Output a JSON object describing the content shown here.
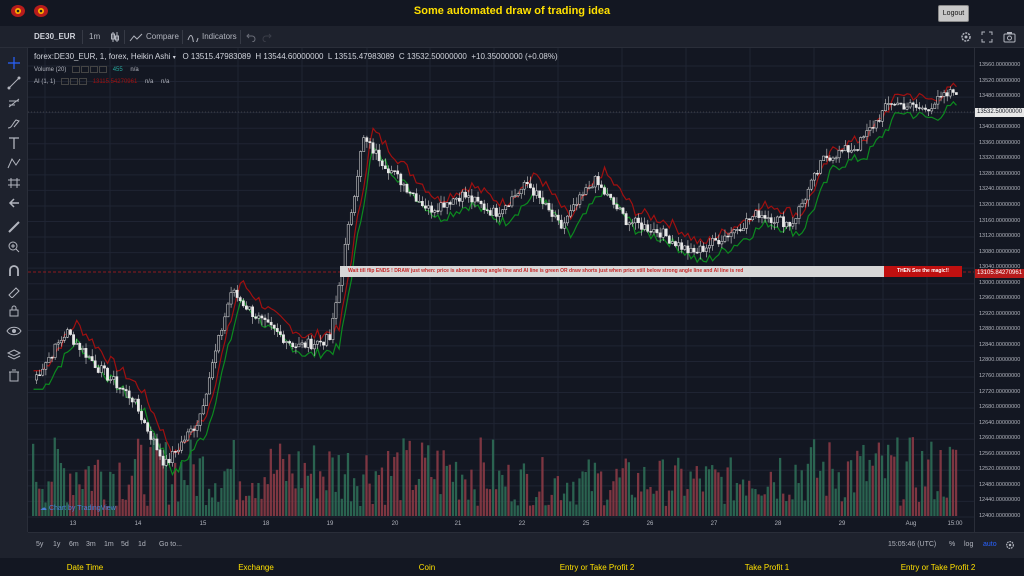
{
  "app": {
    "title": "Some automated draw of trading idea",
    "logout_label": "Logout"
  },
  "toolbar": {
    "symbol": "DE30_EUR",
    "interval": "1m",
    "compare_label": "Compare",
    "indicators_label": "Indicators"
  },
  "legend": {
    "main": "forex:DE30_EUR, 1, forex, Heikin Ashi",
    "open": "O 13515.47983089",
    "high": "H 13544.60000000",
    "low": "L 13515.47983089",
    "close": "C 13532.50000000",
    "change": "+10.35000000 (+0.08%)",
    "volume_label": "Volume (20)",
    "volume_value": "455",
    "volume_na": "n/a",
    "ai_label": "AI (1, 1)",
    "ai_value": "13115.54270961",
    "ai_na1": "n/a",
    "ai_na2": "n/a"
  },
  "banner": {
    "text": "Wait till flip ENDS !   DRAW just when:  price is above strong angle line and AI line is green        OR        draw shorts just when price still below strong angle line and AI line is red",
    "highlight": "THEN See the magic!!"
  },
  "watermark": "Chart by TradingView",
  "price_axis": {
    "labels": [
      "13560.00000000",
      "13520.00000000",
      "13480.00000000",
      "13440.00000000",
      "13400.00000000",
      "13360.00000000",
      "13320.00000000",
      "13280.00000000",
      "13240.00000000",
      "13200.00000000",
      "13160.00000000",
      "13120.00000000",
      "13080.00000000",
      "13040.00000000",
      "13000.00000000",
      "12960.00000000",
      "12920.00000000",
      "12880.00000000",
      "12840.00000000",
      "12800.00000000",
      "12760.00000000",
      "12720.00000000",
      "12680.00000000",
      "12640.00000000",
      "12600.00000000",
      "12560.00000000",
      "12520.00000000",
      "12480.00000000",
      "12440.00000000",
      "12400.00000000"
    ],
    "last_price": "13532.50000000",
    "ai_price": "13105.84270961"
  },
  "time_axis": {
    "labels": [
      "13",
      "14",
      "15",
      "18",
      "19",
      "20",
      "21",
      "22",
      "25",
      "26",
      "27",
      "28",
      "29",
      "Aug",
      "15:00"
    ]
  },
  "bottom": {
    "ranges": [
      "5y",
      "1y",
      "6m",
      "3m",
      "1m",
      "5d",
      "1d"
    ],
    "goto": "Go to...",
    "clock": "15:05:46 (UTC)",
    "percent": "%",
    "log": "log",
    "auto": "auto"
  },
  "footer": {
    "columns": [
      "Date Time",
      "Exchange",
      "Coin",
      "Entry or Take Profit 2",
      "Take Profit 1",
      "Entry or Take Profit 2"
    ]
  },
  "colors": {
    "up": "#26a69a",
    "down": "#ef5350",
    "accent": "#ffe000",
    "ai_green": "#0c8a1f",
    "ai_red": "#a01010"
  },
  "icons": {
    "logo": "eye-logo-icon",
    "settings": "gear-icon",
    "fullscreen": "fullscreen-icon",
    "snapshot": "camera-icon"
  },
  "chart_data": {
    "type": "candlestick",
    "title": "",
    "ylim": [
      12380,
      13600
    ],
    "x_ticks": [
      "13",
      "14",
      "15",
      "18",
      "19",
      "20",
      "21",
      "22",
      "25",
      "26",
      "27",
      "28",
      "29",
      "Aug",
      "15:00"
    ],
    "close_path": [
      {
        "x": "13",
        "y": 12750
      },
      {
        "x": "13",
        "y": 12880
      },
      {
        "x": "14",
        "y": 12780
      },
      {
        "x": "14",
        "y": 12700
      },
      {
        "x": "15",
        "y": 12520
      },
      {
        "x": "15",
        "y": 12640
      },
      {
        "x": "18",
        "y": 12990
      },
      {
        "x": "18",
        "y": 12900
      },
      {
        "x": "19",
        "y": 12840
      },
      {
        "x": "19",
        "y": 12860
      },
      {
        "x": "20",
        "y": 13400
      },
      {
        "x": "20",
        "y": 13300
      },
      {
        "x": "21",
        "y": 13210
      },
      {
        "x": "21",
        "y": 13250
      },
      {
        "x": "22",
        "y": 13200
      },
      {
        "x": "22",
        "y": 13280
      },
      {
        "x": "25",
        "y": 13160
      },
      {
        "x": "25",
        "y": 13290
      },
      {
        "x": "26",
        "y": 13180
      },
      {
        "x": "26",
        "y": 13150
      },
      {
        "x": "27",
        "y": 13090
      },
      {
        "x": "27",
        "y": 13140
      },
      {
        "x": "28",
        "y": 13200
      },
      {
        "x": "28",
        "y": 13170
      },
      {
        "x": "29",
        "y": 13350
      },
      {
        "x": "29",
        "y": 13380
      },
      {
        "x": "Aug",
        "y": 13500
      },
      {
        "x": "Aug",
        "y": 13480
      },
      {
        "x": "15:00",
        "y": 13532.5
      }
    ]
  }
}
